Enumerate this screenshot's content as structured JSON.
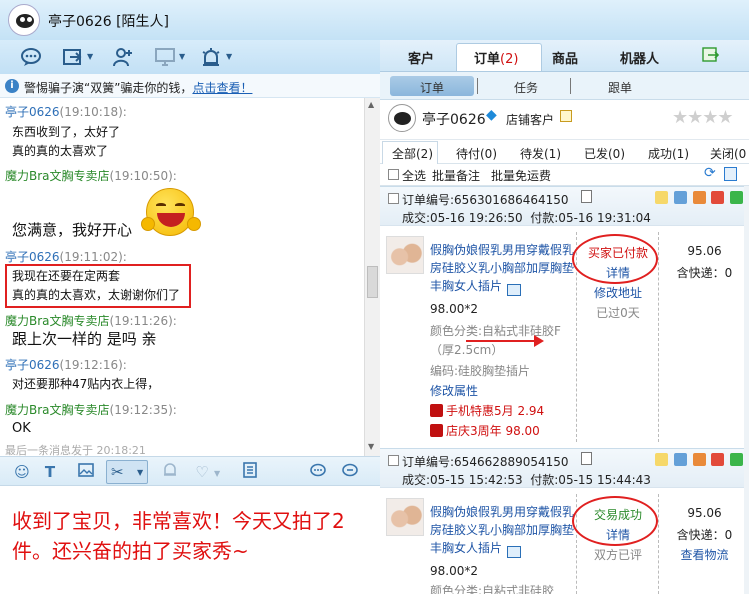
{
  "window": {
    "title": "亭子0626",
    "title_tag": "[陌生人]"
  },
  "left_toolbar": {
    "icons": [
      "chat-icon",
      "share-icon",
      "add-contact-icon",
      "screen-icon",
      "alarm-icon"
    ]
  },
  "notice": {
    "text": "警惕骗子演“双簧”骗走你的钱，",
    "link": "点击查看！"
  },
  "chat": {
    "messages": [
      {
        "sender": "亭子0626",
        "time": "(19:10:18):",
        "role": "buyer",
        "lines": [
          "东西收到了，太好了",
          "真的真的太喜欢了"
        ]
      },
      {
        "sender": "魔力Bra文胸专卖店",
        "time": "(19:10:50):",
        "role": "shop",
        "lines": [
          "您满意，我好开心"
        ]
      },
      {
        "sender": "亭子0626",
        "time": "(19:11:02):",
        "role": "buyer",
        "lines": [
          "我现在还要在定两套",
          "真的真的太喜欢，太谢谢你们了"
        ]
      },
      {
        "sender": "魔力Bra文胸专卖店",
        "time": "(19:11:26):",
        "role": "shop",
        "lines": [
          "跟上次一样的 是吗 亲"
        ]
      },
      {
        "sender": "亭子0626",
        "time": "(19:12:16):",
        "role": "buyer",
        "lines": [
          "对还要那种47贴内衣上得，"
        ]
      },
      {
        "sender": "魔力Bra文胸专卖店",
        "time": "(19:12:35):",
        "role": "shop",
        "lines": [
          "OK"
        ]
      }
    ],
    "last_message_note": "最后一条消息发于 20:18:21"
  },
  "input_toolbar": {
    "icons": [
      "emoji-icon",
      "font-icon",
      "image-icon",
      "scissors-icon",
      "bell-icon",
      "heart-icon",
      "history-icon",
      "chat-send-icon",
      "more-icon"
    ]
  },
  "input": {
    "text": "收到了宝贝，非常喜欢！今天又拍了2件。还兴奋的拍了买家秀~"
  },
  "right_tabs": {
    "items": [
      {
        "label": "客户"
      },
      {
        "label": "订单",
        "count": "(2)"
      },
      {
        "label": "商品"
      },
      {
        "label": "机器人"
      }
    ]
  },
  "sub_tabs": {
    "items": [
      "订单",
      "任务",
      "跟单"
    ]
  },
  "customer": {
    "name": "亭子0626",
    "type": "店铺客户"
  },
  "status_tabs": {
    "items": [
      "全部(2)",
      "待付(0)",
      "待发(1)",
      "已发(0)",
      "成功(1)",
      "关闭(0"
    ]
  },
  "actions": {
    "select_all": "全选",
    "batch_note": "批量备注",
    "batch_free_ship": "批量免运费"
  },
  "orders": [
    {
      "number": "订单编号:656301686464150",
      "deal": "成交:05-16 19:26:50",
      "paid": "付款:05-16 19:31:04",
      "title": "假胸伪娘假乳男用穿戴假乳房硅胶义乳小胸部加厚胸垫丰胸女人插片",
      "price": "98.00*2",
      "color": "颜色分类:自粘式非硅胶F（厚2.5cm）",
      "code": "编码:硅胶胸垫插片",
      "modify_attr": "修改属性",
      "promo1": "手机特惠5月 2.94",
      "promo2": "店庆3周年 98.00",
      "status": "买家已付款",
      "detail": "详情",
      "action": "修改地址",
      "note": "已过0天",
      "amount": "95.06",
      "shipping": "含快递：0"
    },
    {
      "number": "订单编号:654662889054150",
      "deal": "成交:05-15 15:42:53",
      "paid": "付款:05-15 15:44:43",
      "title": "假胸伪娘假乳男用穿戴假乳房硅胶义乳小胸部加厚胸垫丰胸女人插片",
      "price": "98.00*2",
      "color": "颜色分类:自粘式非硅胶",
      "status": "交易成功",
      "detail": "详情",
      "note": "双方已评",
      "amount": "95.06",
      "shipping": "含快递：0",
      "action": "查看物流"
    }
  ],
  "colors": {
    "annotation_red": "#e02020",
    "link_blue": "#1f55a6",
    "shop_green": "#2b8a2b",
    "buyer_blue": "#2e6fb7"
  }
}
